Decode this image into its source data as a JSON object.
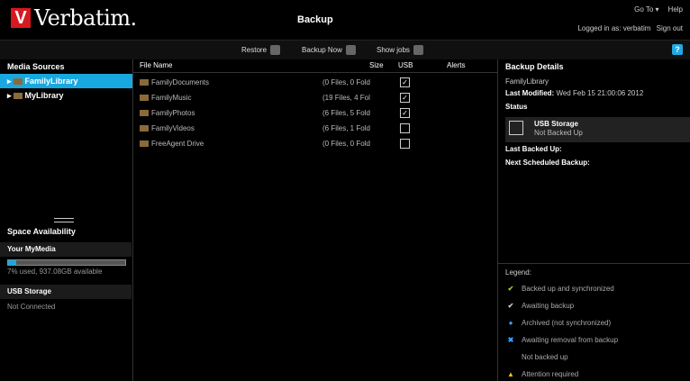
{
  "header": {
    "logo_mark": "V",
    "logo_text": "Verbatim.",
    "title": "Backup",
    "goto": "Go To",
    "goto_arrow": "▾",
    "help": "Help",
    "logged_in": "Logged in as: verbatim",
    "signout": "Sign out"
  },
  "toolbar": {
    "restore": "Restore",
    "backup_now": "Backup Now",
    "show_jobs": "Show jobs",
    "help_icon": "?"
  },
  "media": {
    "title": "Media Sources",
    "items": [
      {
        "label": "FamilyLibrary",
        "selected": true
      },
      {
        "label": "MyLibrary",
        "selected": false
      }
    ]
  },
  "space": {
    "title": "Space Availability",
    "your_media": "Your MyMedia",
    "usage": "7% used, 937.08GB available",
    "usage_percent": 7,
    "usb": "USB Storage",
    "usb_status": "Not Connected"
  },
  "files": {
    "columns": [
      "File Name",
      "Size",
      "USB",
      "Alerts"
    ],
    "rows": [
      {
        "name": "FamilyDocuments",
        "size": "(0 Files, 0 Fold",
        "checked": true
      },
      {
        "name": "FamilyMusic",
        "size": "(19 Files, 4 Fol",
        "checked": true
      },
      {
        "name": "FamilyPhotos",
        "size": "(6 Files, 5 Fold",
        "checked": true
      },
      {
        "name": "FamilyVideos",
        "size": "(6 Files, 1 Fold",
        "checked": false
      },
      {
        "name": "FreeAgent Drive",
        "size": "(0 Files, 0 Fold",
        "checked": false
      }
    ]
  },
  "details": {
    "title": "Backup Details",
    "library": "FamilyLibrary",
    "last_modified_label": "Last Modified:",
    "last_modified_value": "Wed Feb 15 21:00:06 2012",
    "status_label": "Status",
    "usb_title": "USB Storage",
    "usb_status": "Not Backed Up",
    "last_backed_up": "Last Backed Up:",
    "next_backup": "Next Scheduled Backup:"
  },
  "legend": {
    "title": "Legend:",
    "items": [
      {
        "icon": "✔",
        "color": "#9acd32",
        "label": "Backed up and synchronized"
      },
      {
        "icon": "✔",
        "color": "#cccccc",
        "label": "Awaiting backup"
      },
      {
        "icon": "●",
        "color": "#3aa0ff",
        "label": "Archived (not synchronized)"
      },
      {
        "icon": "✖",
        "color": "#3aa0ff",
        "label": "Awaiting removal from backup"
      },
      {
        "icon": "",
        "color": "#888888",
        "label": "Not backed up"
      },
      {
        "icon": "▲",
        "color": "#f0c020",
        "label": "Attention required"
      }
    ]
  }
}
